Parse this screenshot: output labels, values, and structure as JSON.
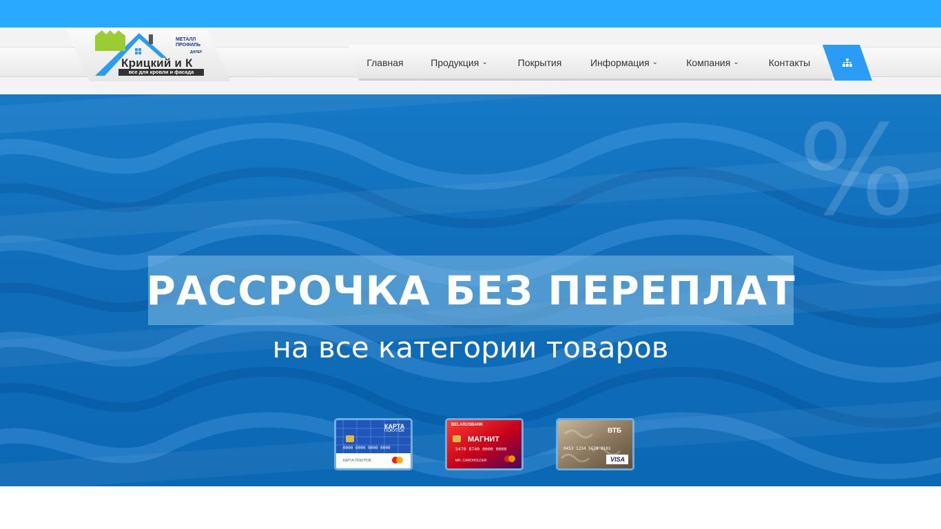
{
  "logo": {
    "name": "Крицкий и К",
    "tagline": "все для кровли и фасада",
    "partner_line1": "МЕТАЛЛ",
    "partner_line2": "ПРОФИЛЬ",
    "partner_dealer": "ДИЛЕР"
  },
  "nav": {
    "items": [
      {
        "label": "Главная",
        "has_dropdown": false
      },
      {
        "label": "Продукция",
        "has_dropdown": true
      },
      {
        "label": "Покрытия",
        "has_dropdown": false
      },
      {
        "label": "Информация",
        "has_dropdown": true
      },
      {
        "label": "Компания",
        "has_dropdown": true
      },
      {
        "label": "Контакты",
        "has_dropdown": false
      }
    ],
    "chevron": "⌄",
    "sitemap_icon": "sitemap-icon"
  },
  "hero": {
    "percent_symbol": "%",
    "headline": "РАССРОЧКА БЕЗ ПЕРЕПЛАТ",
    "subline": "на все категории товаров",
    "cards": [
      {
        "title_line1": "КАРТА",
        "title_line2": "ПОКУПОК",
        "number": "0000 0000 0000 0000",
        "holder": "КАРТА ПОКУПОК",
        "network": "mastercard"
      },
      {
        "bank": "BELARUSBANK",
        "title": "МАГНИТ",
        "number": "5470 8740 0000 0000",
        "holder": "MR. CARDHOLDER",
        "network": "mastercard"
      },
      {
        "bank": "ВТБ",
        "number": "0453 1234 5678 9101",
        "network": "VISA"
      }
    ]
  },
  "colors": {
    "topbar": "#29a9ff",
    "accent": "#2b9cf3",
    "hero": "#0f6db9"
  }
}
